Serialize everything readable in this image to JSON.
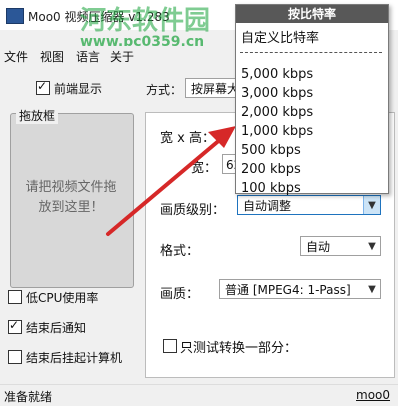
{
  "window": {
    "title": "Moo0 视频压缩器 v1.283"
  },
  "watermark": {
    "text": "河东软件园",
    "url": "www.pc0359.cn"
  },
  "menu": {
    "items": [
      "文件",
      "视图",
      "语言",
      "关于"
    ]
  },
  "options": {
    "always_on_top": "前端显示",
    "low_cpu": "低CPU使用率",
    "notify_after": "结束后通知",
    "shutdown_after": "结束后挂起计算机"
  },
  "dropzone": {
    "title": "拖放框",
    "hint": "请把视频文件拖放到这里！"
  },
  "form": {
    "mode_label": "方式：",
    "mode_value": "按屏幕大小",
    "size_label": "宽 x 高：",
    "width_label": "宽：",
    "width_value": "62",
    "quality_level_label": "画质级别：",
    "quality_level_value": "自动调整",
    "format_label": "格式：",
    "format_value": "自动",
    "quality_label": "画质：",
    "quality_value": "普通  [MPEG4: 1-Pass]",
    "test_part_label": "只测试转换一部分："
  },
  "status": {
    "text": "准备就绪",
    "link": "moo0"
  },
  "popup": {
    "title": "按比特率",
    "custom": "自定义比特率",
    "items": [
      "5,000 kbps",
      "3,000 kbps",
      "2,000 kbps",
      "1,000 kbps",
      "500 kbps",
      "200 kbps",
      "100 kbps"
    ]
  },
  "colors": {
    "arrow": "#d62828",
    "watermark": "#18a33a",
    "popup_header": "#585858"
  }
}
